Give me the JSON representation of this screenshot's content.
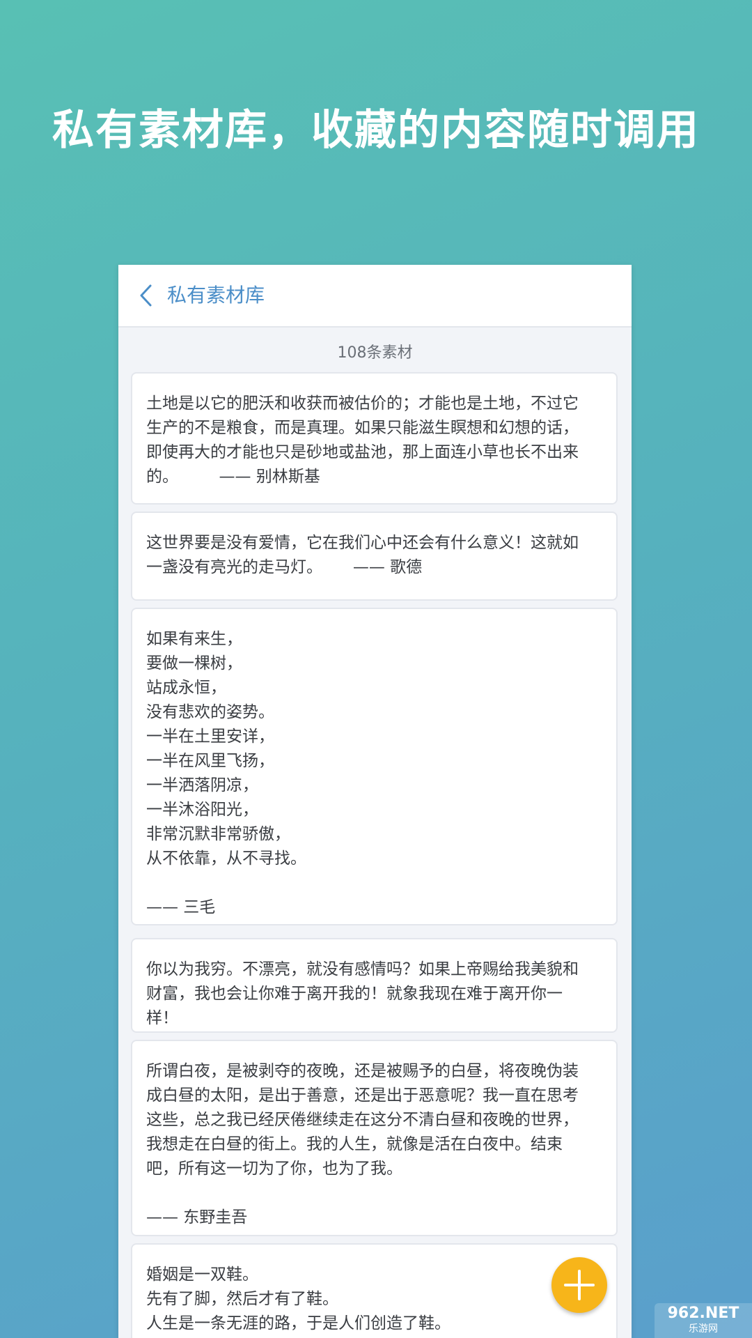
{
  "headline": "私有素材库，收藏的内容随时调用",
  "header": {
    "title": "私有素材库",
    "back_icon": "chevron-left-icon"
  },
  "count_label": "108条素材",
  "cards": [
    {
      "text": "土地是以它的肥沃和收获而被估价的；才能也是土地，不过它\n生产的不是粮食，而是真理。如果只能滋生瞑想和幻想的话，\n即使再大的才能也只是砂地或盐池，那上面连小草也长不出来\n的。        —— 别林斯基"
    },
    {
      "text": "这世界要是没有爱情，它在我们心中还会有什么意义！这就如\n一盏没有亮光的走马灯。      —— 歌德"
    },
    {
      "text": "如果有来生，\n要做一棵树，\n站成永恒，\n没有悲欢的姿势。\n一半在土里安详，\n一半在风里飞扬，\n一半洒落阴凉，\n一半沐浴阳光，\n非常沉默非常骄傲，\n从不依靠，从不寻找。\n\n—— 三毛"
    },
    {
      "text": "你以为我穷。不漂亮，就没有感情吗？如果上帝赐给我美貌和\n财富，我也会让你难于离开我的！就象我现在难于离开你一\n样！"
    },
    {
      "text": "所谓白夜，是被剥夺的夜晚，还是被赐予的白昼，将夜晚伪装\n成白昼的太阳，是出于善意，还是出于恶意呢？我一直在思考\n这些，总之我已经厌倦继续走在这分不清白昼和夜晚的世界，\n我想走在白昼的街上。我的人生，就像是活在白夜中。结束\n吧，所有这一切为了你，也为了我。\n\n—— 东野圭吾"
    },
    {
      "text": "婚姻是一双鞋。\n先有了脚，然后才有了鞋。\n人生是一条无涯的路，于是人们创造了鞋。"
    }
  ],
  "fab": {
    "icon": "plus-icon",
    "color": "#f7b51a"
  },
  "watermark": {
    "main": "962.NET",
    "sub": "乐游网"
  },
  "colors": {
    "accent": "#4b8ec8",
    "fab": "#f7b51a"
  }
}
